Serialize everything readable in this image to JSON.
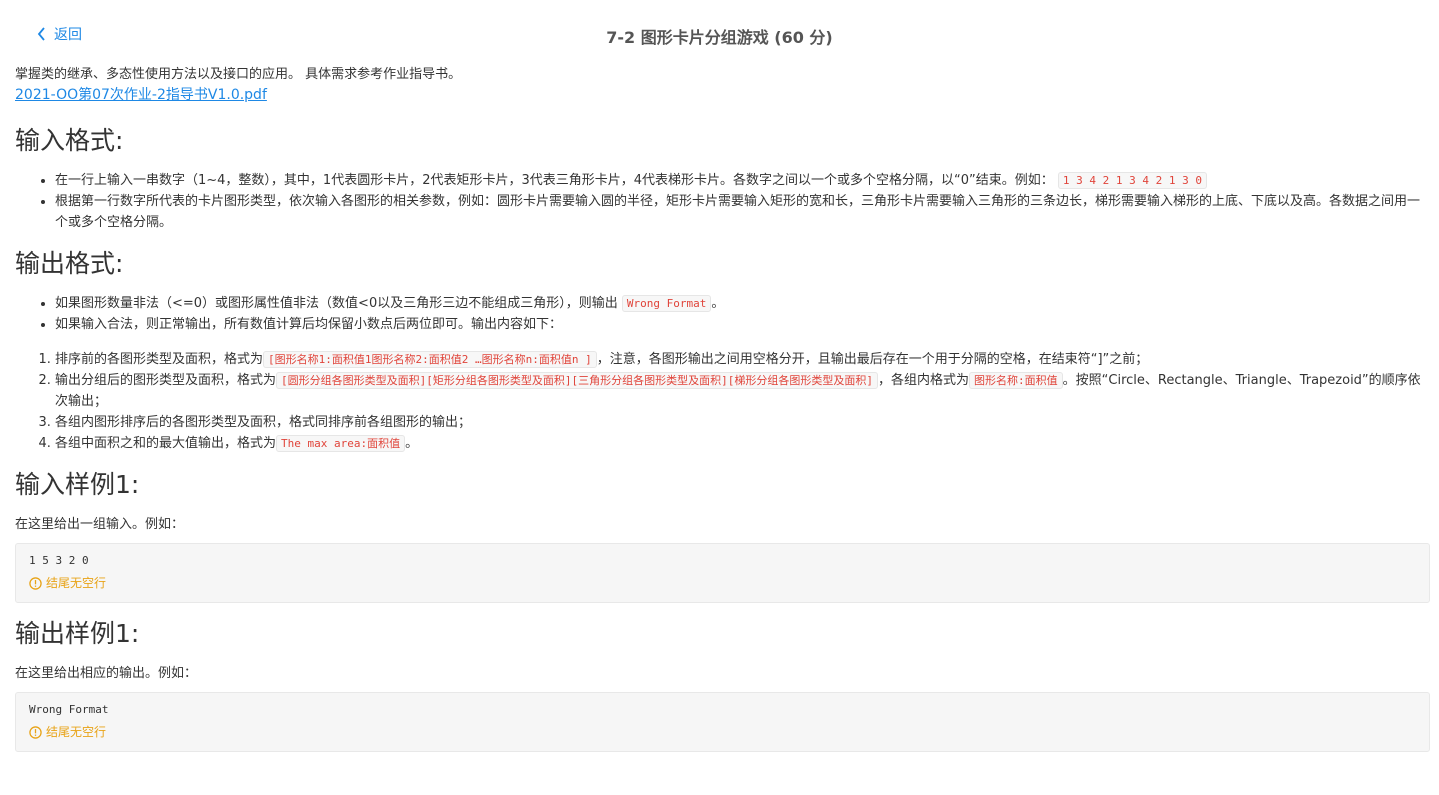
{
  "header": {
    "back_label": "返回",
    "title": "7-2 图形卡片分组游戏 (60 分)"
  },
  "intro": {
    "text": "掌握类的继承、多态性使用方法以及接口的应用。 具体需求参考作业指导书。",
    "link": "2021-OO第07次作业-2指导书V1.0.pdf"
  },
  "input_format": {
    "heading": "输入格式:",
    "item1_text": "在一行上输入一串数字（1~4，整数），其中，1代表圆形卡片，2代表矩形卡片，3代表三角形卡片，4代表梯形卡片。各数字之间以一个或多个空格分隔，以“0”结束。例如：",
    "item1_code": "1 3 4 2 1 3 4 2 1 3 0",
    "item2_text": "根据第一行数字所代表的卡片图形类型，依次输入各图形的相关参数，例如：圆形卡片需要输入圆的半径，矩形卡片需要输入矩形的宽和长，三角形卡片需要输入三角形的三条边长，梯形需要输入梯形的上底、下底以及高。各数据之间用一个或多个空格分隔。"
  },
  "output_format": {
    "heading": "输出格式:",
    "bullet1_text": "如果图形数量非法（<=0）或图形属性值非法（数值<0以及三角形三边不能组成三角形），则输出",
    "bullet1_code": "Wrong Format",
    "bullet1_end": "。",
    "bullet2_text": "如果输入合法，则正常输出，所有数值计算后均保留小数点后两位即可。输出内容如下：",
    "ol1_text": "排序前的各图形类型及面积，格式为",
    "ol1_code": "[图形名称1:面积值1图形名称2:面积值2 …图形名称n:面积值n ]",
    "ol1_end": "，注意，各图形输出之间用空格分开，且输出最后存在一个用于分隔的空格，在结束符“]”之前；",
    "ol2_text": "输出分组后的图形类型及面积，格式为",
    "ol2_code1": "[圆形分组各图形类型及面积][矩形分组各图形类型及面积][三角形分组各图形类型及面积][梯形分组各图形类型及面积]",
    "ol2_mid": "，各组内格式为",
    "ol2_code2": "图形名称:面积值",
    "ol2_end": "。按照“Circle、Rectangle、Triangle、Trapezoid”的顺序依次输出；",
    "ol3_text": "各组内图形排序后的各图形类型及面积，格式同排序前各组图形的输出；",
    "ol4_text": "各组中面积之和的最大值输出，格式为",
    "ol4_code": "The max area:面积值",
    "ol4_end": "。"
  },
  "sample_input": {
    "heading": "输入样例1:",
    "desc": "在这里给出一组输入。例如：",
    "code": "1 5 3 2 0",
    "warning": "结尾无空行"
  },
  "sample_output": {
    "heading": "输出样例1:",
    "desc": "在这里给出相应的输出。例如：",
    "code": "Wrong Format",
    "warning": "结尾无空行"
  },
  "colors": {
    "link": "#1e88e5",
    "code_text": "#e0443a",
    "warning": "#e8a317"
  }
}
